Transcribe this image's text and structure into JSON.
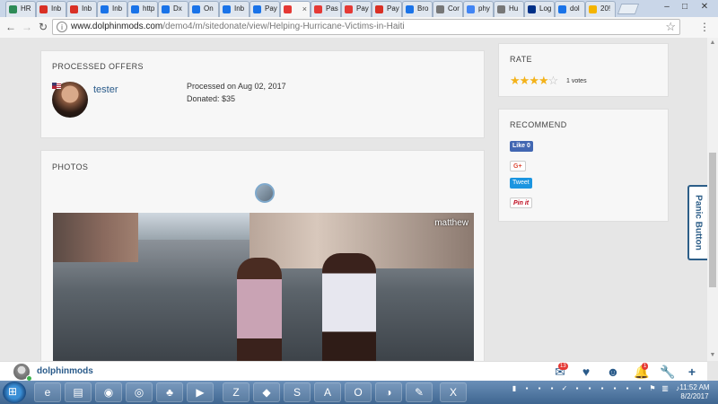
{
  "browser": {
    "tabs": [
      {
        "label": "HR",
        "icon": "leaf-icon",
        "color": "#2e8b57"
      },
      {
        "label": "Inb",
        "icon": "gmail-icon",
        "color": "#d93025"
      },
      {
        "label": "Inb",
        "icon": "gmail-icon",
        "color": "#d93025"
      },
      {
        "label": "Inb",
        "icon": "infinity-icon",
        "color": "#1a73e8"
      },
      {
        "label": "http",
        "icon": "infinity-icon",
        "color": "#1a73e8"
      },
      {
        "label": "Dx",
        "icon": "infinity-icon",
        "color": "#1a73e8"
      },
      {
        "label": "On",
        "icon": "infinity-icon",
        "color": "#1a73e8"
      },
      {
        "label": "Inb",
        "icon": "infinity-icon",
        "color": "#1a73e8"
      },
      {
        "label": "Pay",
        "icon": "infinity-icon",
        "color": "#1a73e8"
      },
      {
        "label": "",
        "icon": "pause-icon",
        "color": "#e53935"
      },
      {
        "label": "Pas",
        "icon": "pause-icon",
        "color": "#e53935"
      },
      {
        "label": "Pay",
        "icon": "pause-icon",
        "color": "#e53935"
      },
      {
        "label": "Pay",
        "icon": "gmail-icon",
        "color": "#d93025"
      },
      {
        "label": "Bro",
        "icon": "gear-icon",
        "color": "#1a73e8"
      },
      {
        "label": "Cor",
        "icon": "puzzle-icon",
        "color": "#777777"
      },
      {
        "label": "phy",
        "icon": "google-icon",
        "color": "#4285f4"
      },
      {
        "label": "Hu",
        "icon": "page-icon",
        "color": "#777777"
      },
      {
        "label": "Log",
        "icon": "paypal-icon",
        "color": "#003087"
      },
      {
        "label": "dol",
        "icon": "dolphin-icon",
        "color": "#1a73e8"
      },
      {
        "label": "20!",
        "icon": "chart-icon",
        "color": "#f4b400"
      }
    ],
    "active_tab_close": "×",
    "url_prefix": "www.dolphinmods.com",
    "url_path": "/demo4/m/sitedonate/view/Helping-Hurricane-Victims-in-Haiti"
  },
  "offers": {
    "title": "PROCESSED OFFERS",
    "user": "tester",
    "processed": "Processed on Aug 02, 2017",
    "donated": "Donated: $35"
  },
  "photos": {
    "title": "PHOTOS",
    "credit": "matthew"
  },
  "rate": {
    "title": "RATE",
    "stars_filled": 4,
    "stars_total": 5,
    "votes": "1 votes"
  },
  "recommend": {
    "title": "RECOMMEND",
    "fb_label": "Like 0",
    "gplus_label": "G+",
    "tweet_label": "Tweet",
    "pin_label": "Pin it"
  },
  "panic_button": "Panic Button",
  "bottom_bar": {
    "username": "dolphinmods",
    "mail_badge": "13",
    "notif_badge": "1"
  },
  "taskbar": {
    "time": "11:52 AM",
    "date": "8/2/2017"
  },
  "colors": {
    "accent": "#2a5b8a",
    "star": "#f3b21a"
  }
}
